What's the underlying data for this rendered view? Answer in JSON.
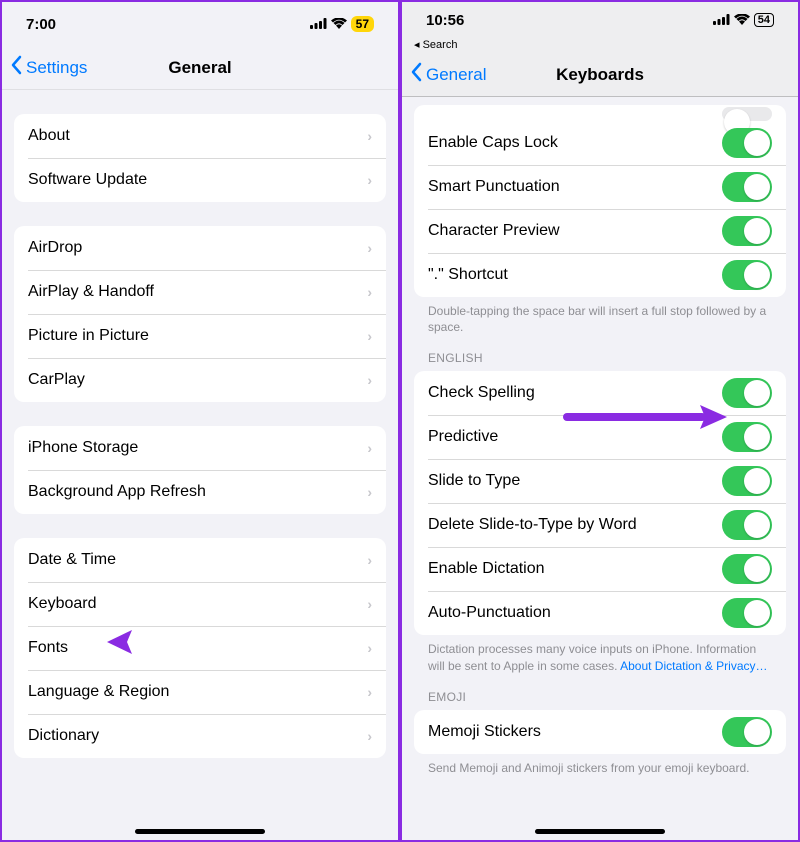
{
  "left": {
    "time": "7:00",
    "signal_icon": "signal-icon",
    "wifi_icon": "wifi-icon",
    "battery_level": "57",
    "back_label": "Settings",
    "title": "General",
    "groups": [
      {
        "items": [
          {
            "label": "About"
          },
          {
            "label": "Software Update"
          }
        ]
      },
      {
        "items": [
          {
            "label": "AirDrop"
          },
          {
            "label": "AirPlay & Handoff"
          },
          {
            "label": "Picture in Picture"
          },
          {
            "label": "CarPlay"
          }
        ]
      },
      {
        "items": [
          {
            "label": "iPhone Storage"
          },
          {
            "label": "Background App Refresh"
          }
        ]
      },
      {
        "items": [
          {
            "label": "Date & Time"
          },
          {
            "label": "Keyboard"
          },
          {
            "label": "Fonts"
          },
          {
            "label": "Language & Region"
          },
          {
            "label": "Dictionary"
          }
        ]
      }
    ]
  },
  "right": {
    "time": "10:56",
    "battery_level": "54",
    "breadcrumb": "Search",
    "back_label": "General",
    "title": "Keyboards",
    "groups": [
      {
        "items": [
          {
            "label": "Enable Caps Lock",
            "toggle": true
          },
          {
            "label": "Smart Punctuation",
            "toggle": true
          },
          {
            "label": "Character Preview",
            "toggle": true
          },
          {
            "label": "\".\" Shortcut",
            "toggle": true
          }
        ],
        "footer": "Double-tapping the space bar will insert a full stop followed by a space."
      },
      {
        "header": "ENGLISH",
        "items": [
          {
            "label": "Check Spelling",
            "toggle": true
          },
          {
            "label": "Predictive",
            "toggle": true
          },
          {
            "label": "Slide to Type",
            "toggle": true
          },
          {
            "label": "Delete Slide-to-Type by Word",
            "toggle": true
          },
          {
            "label": "Enable Dictation",
            "toggle": true
          },
          {
            "label": "Auto-Punctuation",
            "toggle": true
          }
        ],
        "footer_pre": "Dictation processes many voice inputs on iPhone. Information will be sent to Apple in some cases. ",
        "footer_link": "About Dictation & Privacy…"
      },
      {
        "header": "EMOJI",
        "items": [
          {
            "label": "Memoji Stickers",
            "toggle": true
          }
        ],
        "footer": "Send Memoji and Animoji stickers from your emoji keyboard."
      }
    ]
  },
  "annotation_color": "#8a2be2"
}
